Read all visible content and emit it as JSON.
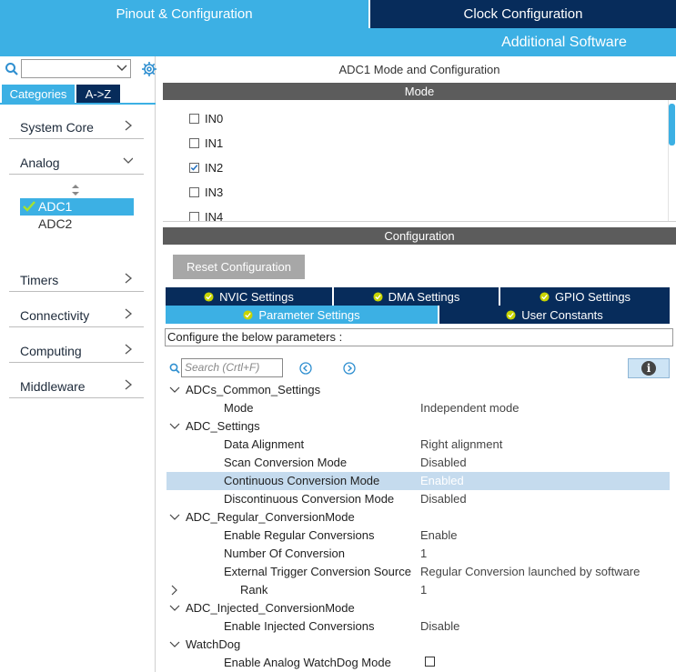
{
  "top_tabs": {
    "pinout": "Pinout & Configuration",
    "clock": "Clock Configuration",
    "additional": "Additional Software"
  },
  "left": {
    "tabs": {
      "categories": "Categories",
      "az": "A->Z"
    },
    "categories": [
      "System Core",
      "Analog",
      "Timers",
      "Connectivity",
      "Computing",
      "Middleware"
    ],
    "analog_items": [
      "ADC1",
      "ADC2"
    ]
  },
  "mode": {
    "title": "ADC1 Mode and Configuration",
    "header": "Mode",
    "channels": [
      {
        "label": "IN0",
        "checked": false
      },
      {
        "label": "IN1",
        "checked": false
      },
      {
        "label": "IN2",
        "checked": true
      },
      {
        "label": "IN3",
        "checked": false
      },
      {
        "label": "IN4",
        "checked": false
      }
    ]
  },
  "config": {
    "header": "Configuration",
    "reset_label": "Reset Configuration",
    "tabs_row1": [
      "NVIC Settings",
      "DMA Settings",
      "GPIO Settings"
    ],
    "tabs_row2": [
      "Parameter Settings",
      "User Constants"
    ],
    "description": "Configure the below parameters :",
    "search_placeholder": "Search (Crtl+F)",
    "info_symbol": "i",
    "groups": {
      "common": {
        "name": "ADCs_Common_Settings",
        "params": [
          {
            "name": "Mode",
            "value": "Independent mode"
          }
        ]
      },
      "adc": {
        "name": "ADC_Settings",
        "params": [
          {
            "name": "Data Alignment",
            "value": "Right alignment"
          },
          {
            "name": "Scan Conversion Mode",
            "value": "Disabled"
          },
          {
            "name": "Continuous Conversion Mode",
            "value": "Enabled"
          },
          {
            "name": "Discontinuous Conversion Mode",
            "value": "Disabled"
          }
        ]
      },
      "regular": {
        "name": "ADC_Regular_ConversionMode",
        "params": [
          {
            "name": "Enable Regular Conversions",
            "value": "Enable"
          },
          {
            "name": "Number Of Conversion",
            "value": "1"
          },
          {
            "name": "External Trigger Conversion Source",
            "value": "Regular Conversion launched by software"
          },
          {
            "name": "Rank",
            "value": "1"
          }
        ]
      },
      "injected": {
        "name": "ADC_Injected_ConversionMode",
        "params": [
          {
            "name": "Enable Injected Conversions",
            "value": "Disable"
          }
        ]
      },
      "watchdog": {
        "name": "WatchDog",
        "params": [
          {
            "name": "Enable Analog WatchDog Mode",
            "checked": false
          }
        ]
      }
    }
  }
}
